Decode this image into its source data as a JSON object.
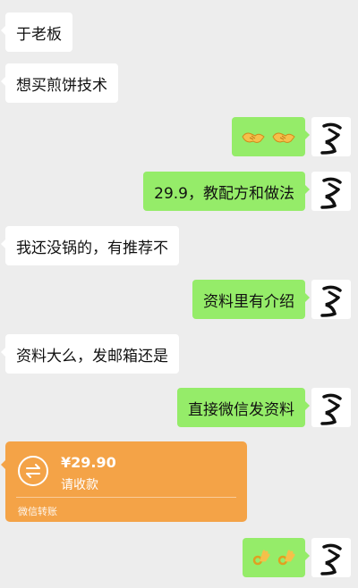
{
  "colors": {
    "background": "#ededed",
    "received_bubble": "#ffffff",
    "sent_bubble": "#95ec69",
    "transfer_card": "#f4a347"
  },
  "messages": [
    {
      "side": "received",
      "text": "于老板"
    },
    {
      "side": "received",
      "text": "想买煎饼技术"
    },
    {
      "side": "sent",
      "type": "emoji",
      "emoji": "handshake-icon x2"
    },
    {
      "side": "sent",
      "text": "29.9，教配方和做法"
    },
    {
      "side": "received",
      "text": "我还没锅的，有推荐不"
    },
    {
      "side": "sent",
      "text": "资料里有介绍"
    },
    {
      "side": "received",
      "text": "资料大么，发邮箱还是"
    },
    {
      "side": "sent",
      "text": "直接微信发资料"
    },
    {
      "side": "sent",
      "type": "emoji",
      "emoji": "ok-hand-icon x2"
    }
  ],
  "transfer": {
    "amount": "¥29.90",
    "description": "请收款",
    "footer": "微信转账",
    "icon": "transfer-arrows-icon"
  },
  "avatar_icon": "calligraphy-avatar-icon"
}
